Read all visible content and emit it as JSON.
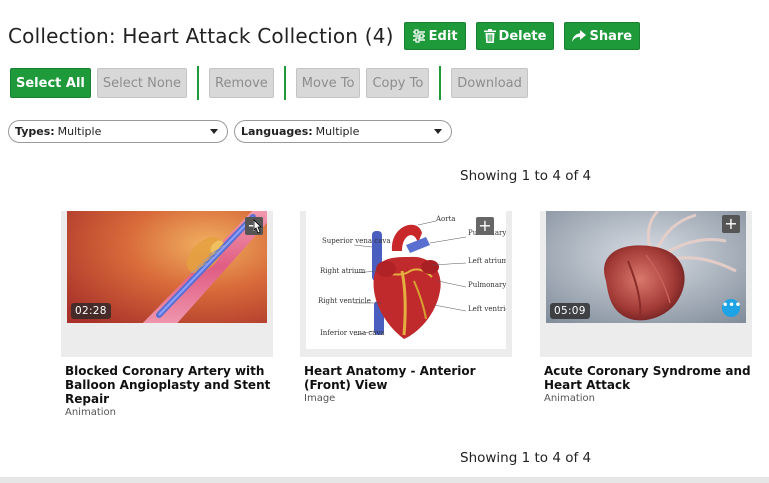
{
  "header": {
    "title": "Collection: Heart Attack Collection (4)",
    "edit_label": "Edit",
    "delete_label": "Delete",
    "share_label": "Share"
  },
  "actions": {
    "select_all": "Select All",
    "select_none": "Select None",
    "remove": "Remove",
    "move_to": "Move To",
    "copy_to": "Copy To",
    "download": "Download"
  },
  "filters": {
    "types_label": "Types:",
    "types_value": "Multiple",
    "languages_label": "Languages:",
    "languages_value": "Multiple"
  },
  "showing_text": "Showing 1 to 4 of 4",
  "cards": [
    {
      "title": "Blocked Coronary Artery with Balloon Angioplasty and Stent Repair",
      "type": "Animation",
      "duration": "02:28",
      "icon": "artery-stent-thumbnail"
    },
    {
      "title": "Heart Anatomy - Anterior (Front) View",
      "type": "Image",
      "icon": "heart-anatomy-diagram-thumbnail",
      "diagram_labels": [
        "Aorta",
        "Superior vena cava",
        "Pulmonary trunk",
        "Left atrium",
        "Right atrium",
        "Pulmonary veins",
        "Right ventricle",
        "Left ventricle",
        "Inferior vena cava"
      ]
    },
    {
      "title": "Acute Coronary Syndrome and Heart Attack",
      "type": "Animation",
      "duration": "05:09",
      "icon": "heart-3d-thumbnail"
    }
  ],
  "colors": {
    "accent_green": "#1f9a3b",
    "disabled_gray": "#d8d8d8"
  }
}
